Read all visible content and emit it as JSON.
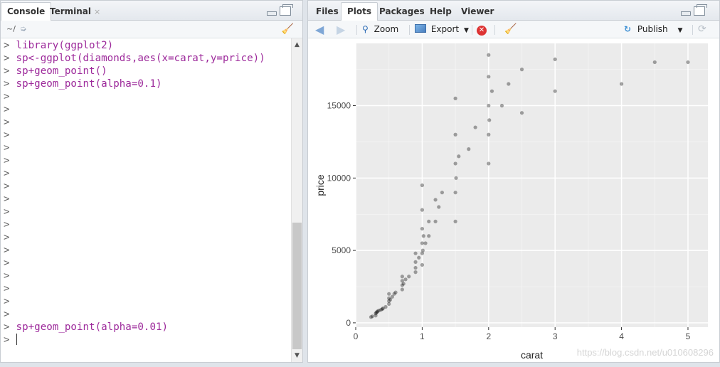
{
  "console_pane": {
    "tabs": [
      {
        "label": "Console"
      },
      {
        "label": "Terminal",
        "close": "×"
      }
    ],
    "path": "~/",
    "prompt": ">",
    "lines": [
      "library(ggplot2)",
      "sp<-ggplot(diamonds,aes(x=carat,y=price))",
      "sp+geom_point()",
      "sp+geom_point(alpha=0.1)",
      "",
      "",
      "",
      "",
      "",
      "",
      "",
      "",
      "",
      "",
      "",
      "",
      "",
      "",
      "",
      "",
      "",
      "",
      "sp+geom_point(alpha=0.01)",
      ""
    ]
  },
  "plots_pane": {
    "tabs": [
      {
        "label": "Files"
      },
      {
        "label": "Plots"
      },
      {
        "label": "Packages"
      },
      {
        "label": "Help"
      },
      {
        "label": "Viewer"
      }
    ],
    "toolbar": {
      "zoom": "Zoom",
      "export": "Export",
      "publish": "Publish"
    }
  },
  "chart_data": {
    "type": "scatter",
    "title": "",
    "xlabel": "carat",
    "ylabel": "price",
    "xlim": [
      0.0,
      5.3
    ],
    "ylim": [
      -300,
      19300
    ],
    "x_ticks": [
      0,
      1,
      2,
      3,
      4,
      5
    ],
    "y_ticks": [
      0,
      5000,
      10000,
      15000
    ],
    "grid": true,
    "point_alpha": 0.01,
    "point_color": "#000000",
    "panel_bg": "#ebebeb",
    "series": [
      {
        "values": [
          [
            0.23,
            400
          ],
          [
            0.25,
            450
          ],
          [
            0.3,
            500
          ],
          [
            0.3,
            650
          ],
          [
            0.31,
            700
          ],
          [
            0.32,
            750
          ],
          [
            0.33,
            800
          ],
          [
            0.35,
            850
          ],
          [
            0.38,
            900
          ],
          [
            0.4,
            950
          ],
          [
            0.41,
            1000
          ],
          [
            0.45,
            1100
          ],
          [
            0.5,
            1300
          ],
          [
            0.5,
            1500
          ],
          [
            0.5,
            1700
          ],
          [
            0.5,
            2000
          ],
          [
            0.52,
            1600
          ],
          [
            0.55,
            1800
          ],
          [
            0.58,
            2000
          ],
          [
            0.6,
            2100
          ],
          [
            0.7,
            2300
          ],
          [
            0.7,
            2600
          ],
          [
            0.7,
            2900
          ],
          [
            0.7,
            3200
          ],
          [
            0.72,
            2700
          ],
          [
            0.75,
            3000
          ],
          [
            0.8,
            3200
          ],
          [
            0.9,
            3500
          ],
          [
            0.9,
            3800
          ],
          [
            0.9,
            4200
          ],
          [
            0.9,
            4800
          ],
          [
            0.95,
            4500
          ],
          [
            1.0,
            4000
          ],
          [
            1.0,
            4800
          ],
          [
            1.0,
            5500
          ],
          [
            1.0,
            6500
          ],
          [
            1.0,
            7800
          ],
          [
            1.0,
            9500
          ],
          [
            1.01,
            5000
          ],
          [
            1.02,
            6000
          ],
          [
            1.05,
            5500
          ],
          [
            1.1,
            6000
          ],
          [
            1.1,
            7000
          ],
          [
            1.2,
            7000
          ],
          [
            1.2,
            8500
          ],
          [
            1.25,
            8000
          ],
          [
            1.3,
            9000
          ],
          [
            1.5,
            7000
          ],
          [
            1.5,
            9000
          ],
          [
            1.5,
            11000
          ],
          [
            1.5,
            13000
          ],
          [
            1.5,
            15500
          ],
          [
            1.51,
            10000
          ],
          [
            1.55,
            11500
          ],
          [
            1.7,
            12000
          ],
          [
            1.8,
            13500
          ],
          [
            2.0,
            11000
          ],
          [
            2.0,
            13000
          ],
          [
            2.0,
            15000
          ],
          [
            2.0,
            17000
          ],
          [
            2.0,
            18500
          ],
          [
            2.01,
            14000
          ],
          [
            2.05,
            16000
          ],
          [
            2.2,
            15000
          ],
          [
            2.3,
            16500
          ],
          [
            2.5,
            14500
          ],
          [
            2.5,
            17500
          ],
          [
            3.0,
            16000
          ],
          [
            3.0,
            18200
          ],
          [
            4.0,
            16500
          ],
          [
            4.5,
            18000
          ],
          [
            5.0,
            18000
          ]
        ]
      }
    ]
  }
}
